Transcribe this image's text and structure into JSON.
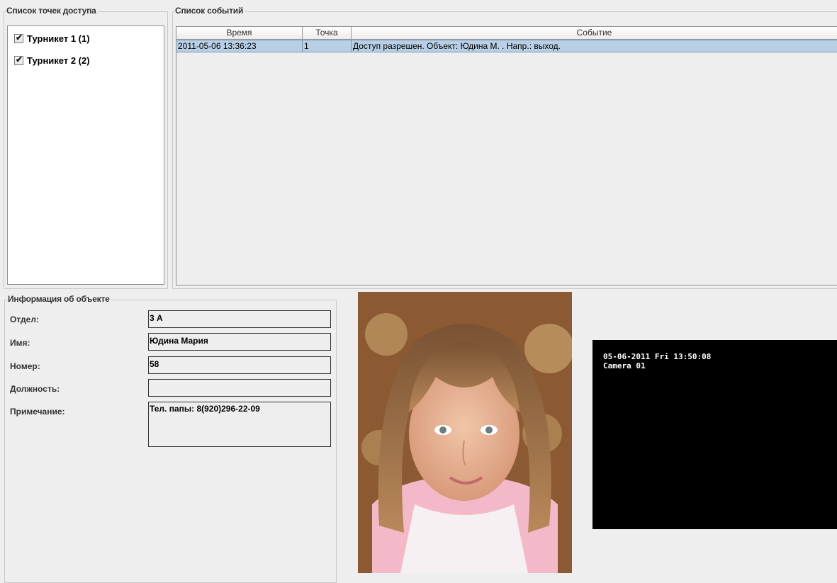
{
  "access_points": {
    "title": "Список точек доступа",
    "items": [
      {
        "label": "Турникет 1 (1)",
        "checked": true
      },
      {
        "label": "Турникет 2 (2)",
        "checked": true
      }
    ]
  },
  "events": {
    "title": "Список событий",
    "columns": [
      "Время",
      "Точка",
      "Событие"
    ],
    "rows": [
      {
        "time": "2011-05-06 13:36:23",
        "point": "1",
        "event": "Доступ разрешен. Объект: Юдина М. . Напр.: выход."
      }
    ]
  },
  "object_info": {
    "title": "Информация об объекте",
    "fields": [
      {
        "label": "Отдел:",
        "value": "3 А"
      },
      {
        "label": "Имя:",
        "value": "Юдина Мария"
      },
      {
        "label": "Номер:",
        "value": "58"
      },
      {
        "label": "Должность:",
        "value": ""
      },
      {
        "label": "Примечание:",
        "value": "Тел. папы: 8(920)296-22-09"
      }
    ]
  },
  "camera": {
    "timestamp": "05-06-2011 Fri 13:50:08",
    "name": "Camera 01"
  }
}
